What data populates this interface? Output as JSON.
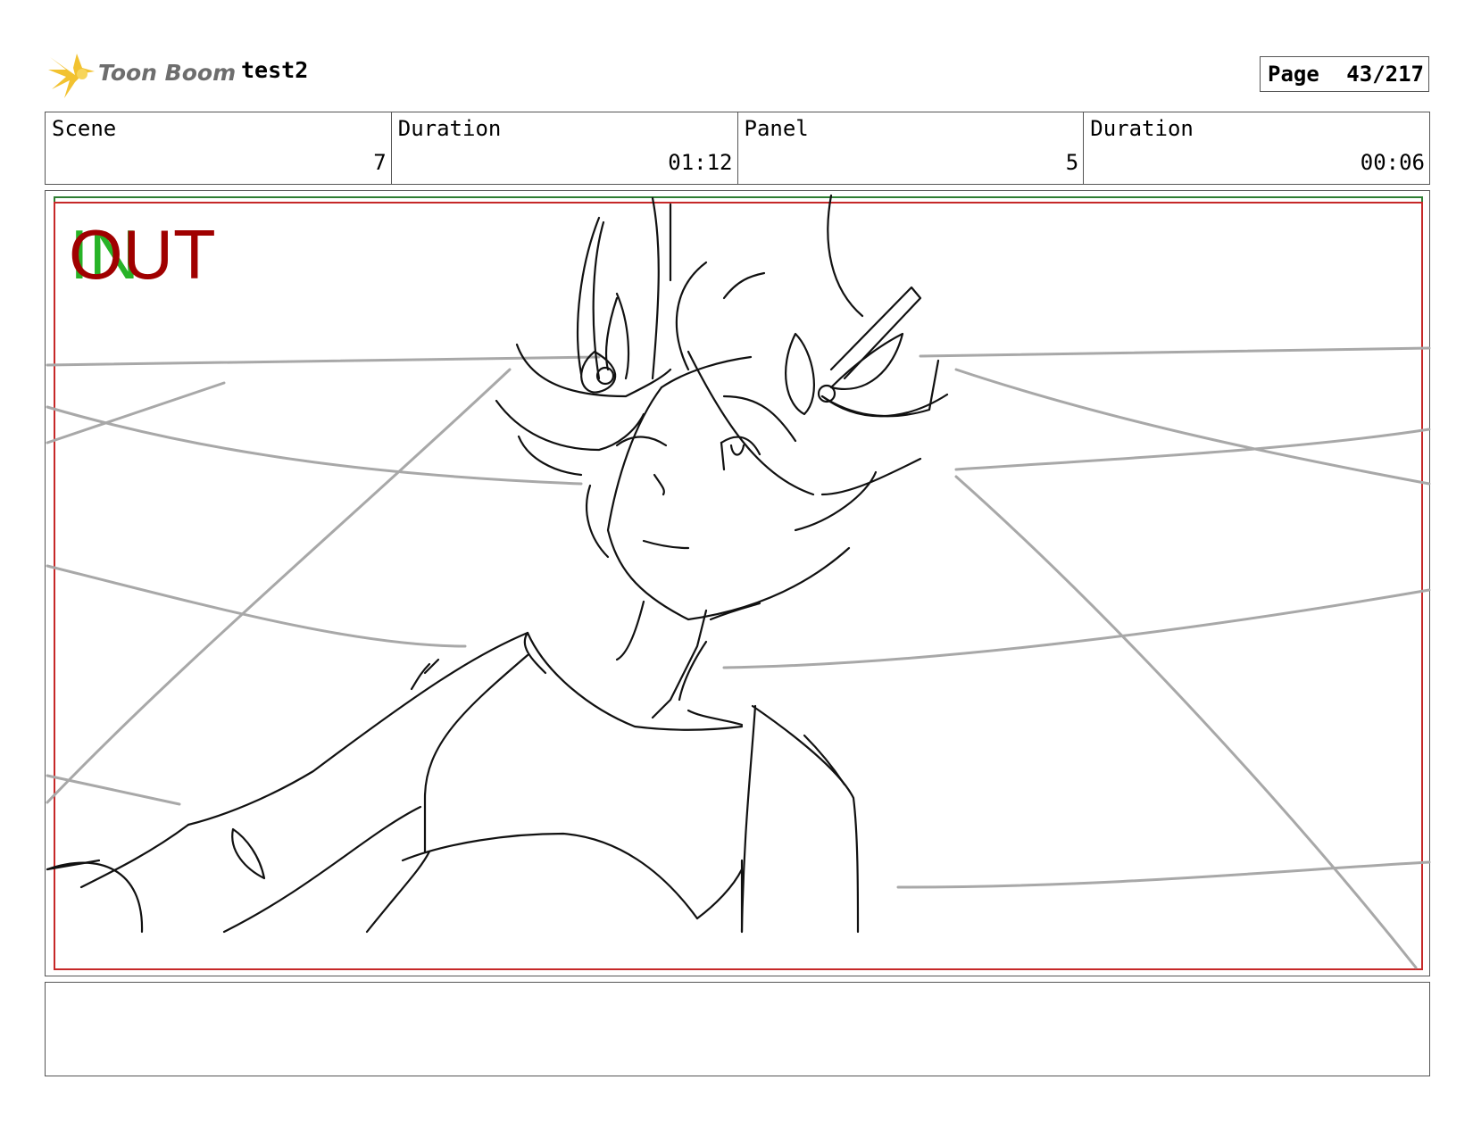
{
  "header": {
    "brand": "Toon Boom",
    "project": "test2",
    "page_label": "Page",
    "page_value": "43/217"
  },
  "info": [
    {
      "label": "Scene",
      "value": "7"
    },
    {
      "label": "Duration",
      "value": "01:12"
    },
    {
      "label": "Panel",
      "value": "5"
    },
    {
      "label": "Duration",
      "value": "00:06"
    }
  ],
  "panel": {
    "in_label": "IN",
    "out_label": "OUT"
  },
  "notes": {
    "text": ""
  },
  "colors": {
    "in_mark": "#27b327",
    "out_mark": "#a00000",
    "safe_frame": "#2e7d32",
    "cam_frame": "#c62828",
    "background_lines": "#a8a8a8",
    "sketch_lines": "#111111"
  }
}
